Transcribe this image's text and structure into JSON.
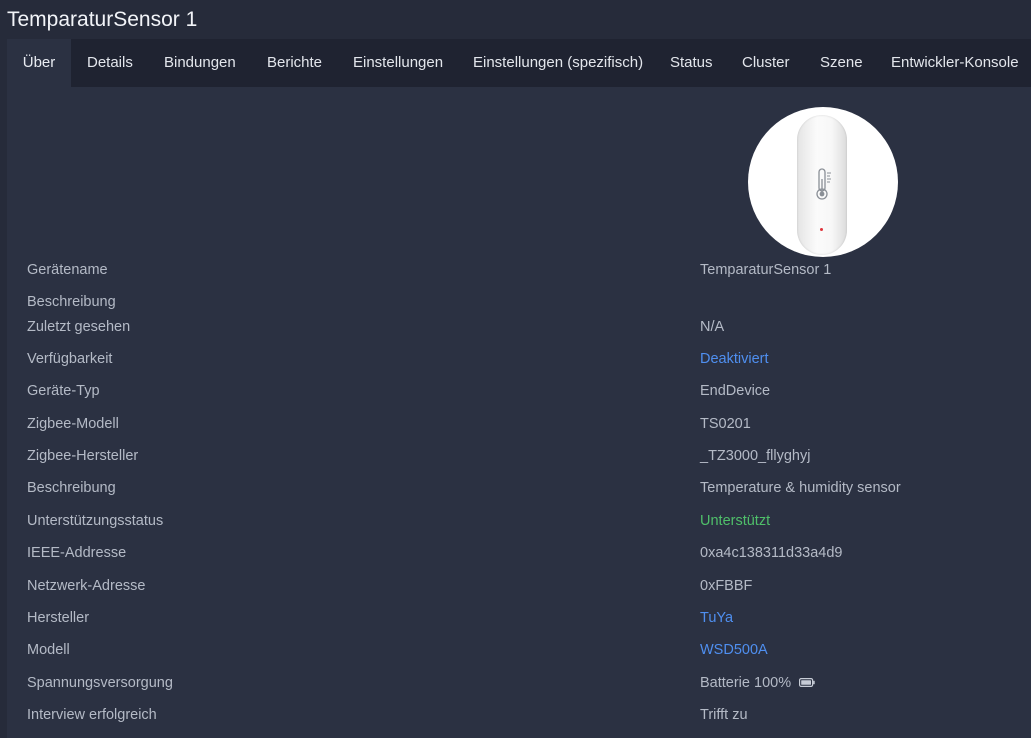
{
  "window": {
    "title": "TemparaturSensor 1"
  },
  "tabs": [
    {
      "label": "Über",
      "active": true
    },
    {
      "label": "Details",
      "active": false
    },
    {
      "label": "Bindungen",
      "active": false
    },
    {
      "label": "Berichte",
      "active": false
    },
    {
      "label": "Einstellungen",
      "active": false
    },
    {
      "label": "Einstellungen (spezifisch)",
      "active": false
    },
    {
      "label": "Status",
      "active": false
    },
    {
      "label": "Cluster",
      "active": false
    },
    {
      "label": "Szene",
      "active": false
    },
    {
      "label": "Entwickler-Konsole",
      "active": false
    }
  ],
  "device_image": {
    "icon": "thermometer-icon"
  },
  "info": {
    "device_name_label": "Gerätename",
    "device_name_value": "TemparaturSensor 1",
    "description_label": "Beschreibung",
    "description_value": "",
    "last_seen_label": "Zuletzt gesehen",
    "last_seen_value": "N/A",
    "availability_label": "Verfügbarkeit",
    "availability_value": "Deaktiviert",
    "device_type_label": "Geräte-Typ",
    "device_type_value": "EndDevice",
    "zigbee_model_label": "Zigbee-Modell",
    "zigbee_model_value": "TS0201",
    "zigbee_manufacturer_label": "Zigbee-Hersteller",
    "zigbee_manufacturer_value": "_TZ3000_fllyghyj",
    "description2_label": "Beschreibung",
    "description2_value": "Temperature & humidity sensor",
    "support_status_label": "Unterstützungsstatus",
    "support_status_value": "Unterstützt",
    "ieee_label": "IEEE-Addresse",
    "ieee_value": "0xa4c138311d33a4d9",
    "network_label": "Netzwerk-Adresse",
    "network_value": "0xFBBF",
    "manufacturer_label": "Hersteller",
    "manufacturer_value": "TuYa",
    "model_label": "Modell",
    "model_value": "WSD500A",
    "power_label": "Spannungsversorgung",
    "power_value": "Batterie 100%",
    "power_icon": "battery-icon",
    "interview_label": "Interview erfolgreich",
    "interview_value": "Trifft zu"
  },
  "colors": {
    "background": "#262b3a",
    "panel": "#2b3142",
    "tabbar": "#1f2331",
    "link": "#4f8ff0",
    "success": "#4fbf6a"
  }
}
